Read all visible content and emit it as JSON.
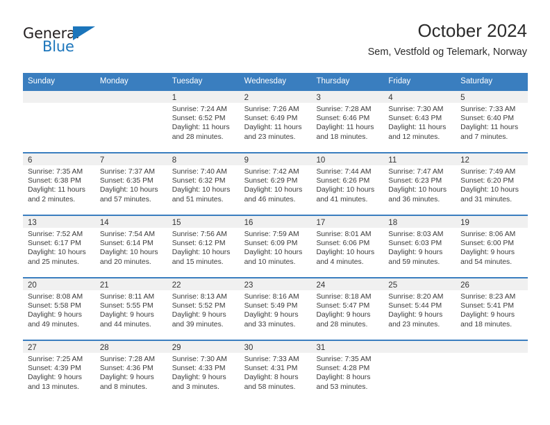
{
  "brand": {
    "name_top": "General",
    "name_bottom": "Blue",
    "triangle_color": "#1b75bb",
    "text_color": "#231f20"
  },
  "header": {
    "title": "October 2024",
    "subtitle": "Sem, Vestfold og Telemark, Norway"
  },
  "theme": {
    "header_blue": "#3a7ebf",
    "day_band_gray": "#f0f0f0",
    "text_gray": "#3a3a3a"
  },
  "weekdays": [
    "Sunday",
    "Monday",
    "Tuesday",
    "Wednesday",
    "Thursday",
    "Friday",
    "Saturday"
  ],
  "weeks": [
    [
      {
        "day": "",
        "empty": true
      },
      {
        "day": "",
        "empty": true
      },
      {
        "day": "1",
        "sunrise": "Sunrise: 7:24 AM",
        "sunset": "Sunset: 6:52 PM",
        "daylight1": "Daylight: 11 hours",
        "daylight2": "and 28 minutes."
      },
      {
        "day": "2",
        "sunrise": "Sunrise: 7:26 AM",
        "sunset": "Sunset: 6:49 PM",
        "daylight1": "Daylight: 11 hours",
        "daylight2": "and 23 minutes."
      },
      {
        "day": "3",
        "sunrise": "Sunrise: 7:28 AM",
        "sunset": "Sunset: 6:46 PM",
        "daylight1": "Daylight: 11 hours",
        "daylight2": "and 18 minutes."
      },
      {
        "day": "4",
        "sunrise": "Sunrise: 7:30 AM",
        "sunset": "Sunset: 6:43 PM",
        "daylight1": "Daylight: 11 hours",
        "daylight2": "and 12 minutes."
      },
      {
        "day": "5",
        "sunrise": "Sunrise: 7:33 AM",
        "sunset": "Sunset: 6:40 PM",
        "daylight1": "Daylight: 11 hours",
        "daylight2": "and 7 minutes."
      }
    ],
    [
      {
        "day": "6",
        "sunrise": "Sunrise: 7:35 AM",
        "sunset": "Sunset: 6:38 PM",
        "daylight1": "Daylight: 11 hours",
        "daylight2": "and 2 minutes."
      },
      {
        "day": "7",
        "sunrise": "Sunrise: 7:37 AM",
        "sunset": "Sunset: 6:35 PM",
        "daylight1": "Daylight: 10 hours",
        "daylight2": "and 57 minutes."
      },
      {
        "day": "8",
        "sunrise": "Sunrise: 7:40 AM",
        "sunset": "Sunset: 6:32 PM",
        "daylight1": "Daylight: 10 hours",
        "daylight2": "and 51 minutes."
      },
      {
        "day": "9",
        "sunrise": "Sunrise: 7:42 AM",
        "sunset": "Sunset: 6:29 PM",
        "daylight1": "Daylight: 10 hours",
        "daylight2": "and 46 minutes."
      },
      {
        "day": "10",
        "sunrise": "Sunrise: 7:44 AM",
        "sunset": "Sunset: 6:26 PM",
        "daylight1": "Daylight: 10 hours",
        "daylight2": "and 41 minutes."
      },
      {
        "day": "11",
        "sunrise": "Sunrise: 7:47 AM",
        "sunset": "Sunset: 6:23 PM",
        "daylight1": "Daylight: 10 hours",
        "daylight2": "and 36 minutes."
      },
      {
        "day": "12",
        "sunrise": "Sunrise: 7:49 AM",
        "sunset": "Sunset: 6:20 PM",
        "daylight1": "Daylight: 10 hours",
        "daylight2": "and 31 minutes."
      }
    ],
    [
      {
        "day": "13",
        "sunrise": "Sunrise: 7:52 AM",
        "sunset": "Sunset: 6:17 PM",
        "daylight1": "Daylight: 10 hours",
        "daylight2": "and 25 minutes."
      },
      {
        "day": "14",
        "sunrise": "Sunrise: 7:54 AM",
        "sunset": "Sunset: 6:14 PM",
        "daylight1": "Daylight: 10 hours",
        "daylight2": "and 20 minutes."
      },
      {
        "day": "15",
        "sunrise": "Sunrise: 7:56 AM",
        "sunset": "Sunset: 6:12 PM",
        "daylight1": "Daylight: 10 hours",
        "daylight2": "and 15 minutes."
      },
      {
        "day": "16",
        "sunrise": "Sunrise: 7:59 AM",
        "sunset": "Sunset: 6:09 PM",
        "daylight1": "Daylight: 10 hours",
        "daylight2": "and 10 minutes."
      },
      {
        "day": "17",
        "sunrise": "Sunrise: 8:01 AM",
        "sunset": "Sunset: 6:06 PM",
        "daylight1": "Daylight: 10 hours",
        "daylight2": "and 4 minutes."
      },
      {
        "day": "18",
        "sunrise": "Sunrise: 8:03 AM",
        "sunset": "Sunset: 6:03 PM",
        "daylight1": "Daylight: 9 hours",
        "daylight2": "and 59 minutes."
      },
      {
        "day": "19",
        "sunrise": "Sunrise: 8:06 AM",
        "sunset": "Sunset: 6:00 PM",
        "daylight1": "Daylight: 9 hours",
        "daylight2": "and 54 minutes."
      }
    ],
    [
      {
        "day": "20",
        "sunrise": "Sunrise: 8:08 AM",
        "sunset": "Sunset: 5:58 PM",
        "daylight1": "Daylight: 9 hours",
        "daylight2": "and 49 minutes."
      },
      {
        "day": "21",
        "sunrise": "Sunrise: 8:11 AM",
        "sunset": "Sunset: 5:55 PM",
        "daylight1": "Daylight: 9 hours",
        "daylight2": "and 44 minutes."
      },
      {
        "day": "22",
        "sunrise": "Sunrise: 8:13 AM",
        "sunset": "Sunset: 5:52 PM",
        "daylight1": "Daylight: 9 hours",
        "daylight2": "and 39 minutes."
      },
      {
        "day": "23",
        "sunrise": "Sunrise: 8:16 AM",
        "sunset": "Sunset: 5:49 PM",
        "daylight1": "Daylight: 9 hours",
        "daylight2": "and 33 minutes."
      },
      {
        "day": "24",
        "sunrise": "Sunrise: 8:18 AM",
        "sunset": "Sunset: 5:47 PM",
        "daylight1": "Daylight: 9 hours",
        "daylight2": "and 28 minutes."
      },
      {
        "day": "25",
        "sunrise": "Sunrise: 8:20 AM",
        "sunset": "Sunset: 5:44 PM",
        "daylight1": "Daylight: 9 hours",
        "daylight2": "and 23 minutes."
      },
      {
        "day": "26",
        "sunrise": "Sunrise: 8:23 AM",
        "sunset": "Sunset: 5:41 PM",
        "daylight1": "Daylight: 9 hours",
        "daylight2": "and 18 minutes."
      }
    ],
    [
      {
        "day": "27",
        "sunrise": "Sunrise: 7:25 AM",
        "sunset": "Sunset: 4:39 PM",
        "daylight1": "Daylight: 9 hours",
        "daylight2": "and 13 minutes."
      },
      {
        "day": "28",
        "sunrise": "Sunrise: 7:28 AM",
        "sunset": "Sunset: 4:36 PM",
        "daylight1": "Daylight: 9 hours",
        "daylight2": "and 8 minutes."
      },
      {
        "day": "29",
        "sunrise": "Sunrise: 7:30 AM",
        "sunset": "Sunset: 4:33 PM",
        "daylight1": "Daylight: 9 hours",
        "daylight2": "and 3 minutes."
      },
      {
        "day": "30",
        "sunrise": "Sunrise: 7:33 AM",
        "sunset": "Sunset: 4:31 PM",
        "daylight1": "Daylight: 8 hours",
        "daylight2": "and 58 minutes."
      },
      {
        "day": "31",
        "sunrise": "Sunrise: 7:35 AM",
        "sunset": "Sunset: 4:28 PM",
        "daylight1": "Daylight: 8 hours",
        "daylight2": "and 53 minutes."
      },
      {
        "day": "",
        "empty": true
      },
      {
        "day": "",
        "empty": true
      }
    ]
  ]
}
